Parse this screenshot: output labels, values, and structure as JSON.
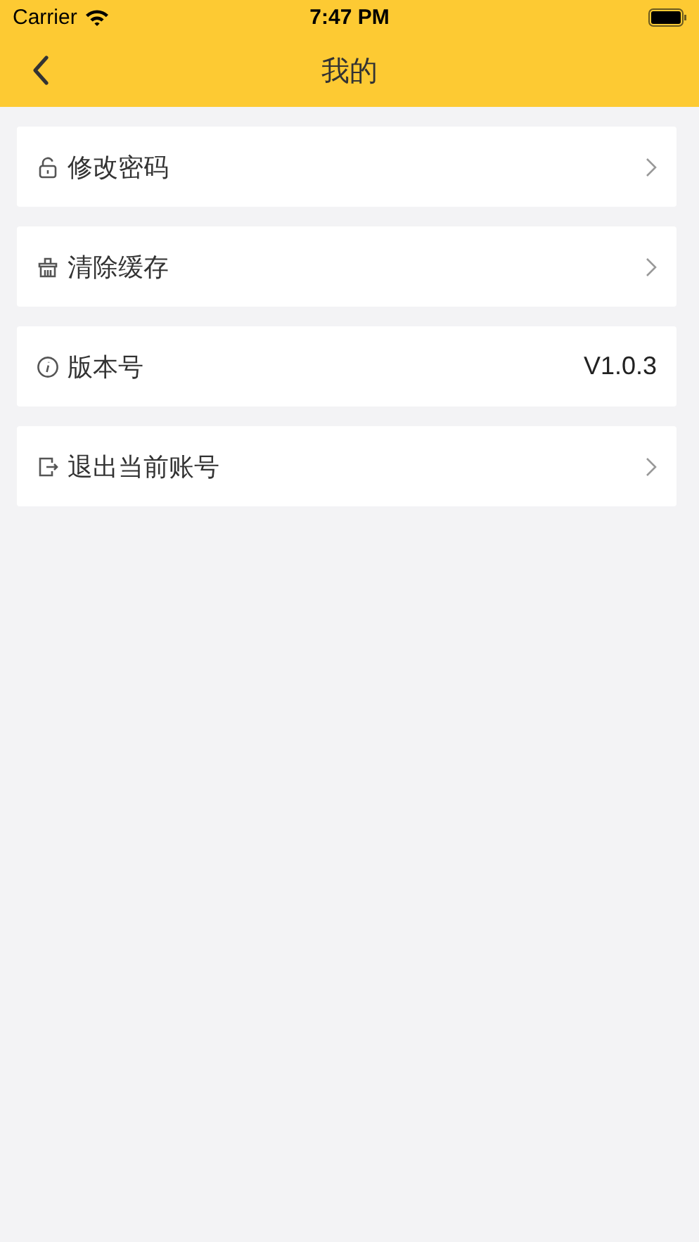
{
  "status_bar": {
    "carrier": "Carrier",
    "time": "7:47 PM"
  },
  "nav_bar": {
    "title": "我的"
  },
  "items": [
    {
      "kind": "link",
      "label": "修改密码"
    },
    {
      "kind": "link",
      "label": "清除缓存"
    },
    {
      "kind": "value",
      "label": "版本号",
      "value": "V1.0.3"
    },
    {
      "kind": "link",
      "label": "退出当前账号"
    }
  ]
}
